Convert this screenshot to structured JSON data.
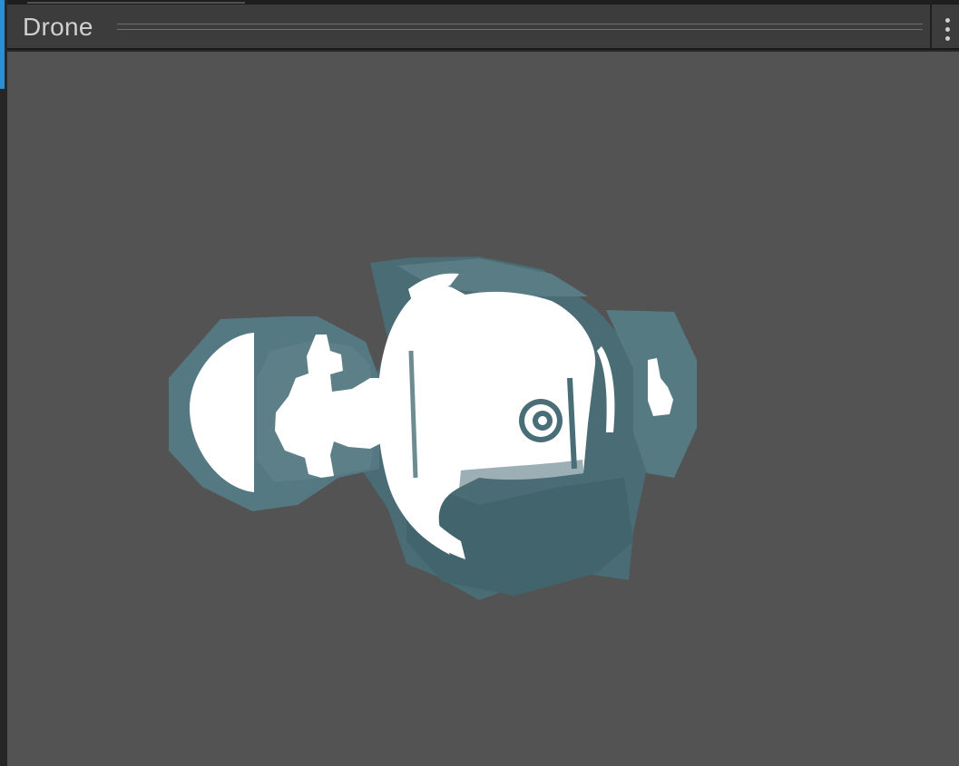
{
  "window": {
    "title": "Drone",
    "menu_icon": "kebab-menu-icon"
  },
  "preview": {
    "subject": "drone-model",
    "background_color": "#535353",
    "hull_color": "#4a6f78",
    "highlight_color": "#ffffff"
  }
}
